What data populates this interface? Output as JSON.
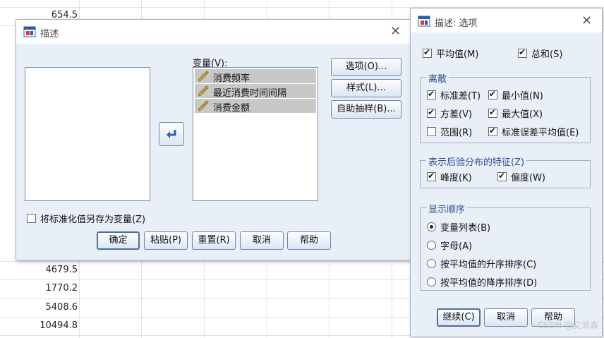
{
  "sheet": {
    "values_top": [
      "654.5"
    ],
    "values_bottom": [
      "4679.5",
      "1770.2",
      "5408.6",
      "10494.8"
    ]
  },
  "describe": {
    "title": "描述",
    "variables_label": "变量(V):",
    "variables": [
      "消费频率",
      "最近消费时间间隔",
      "消费金额"
    ],
    "save_standardized_label": "将标准化值另存为变量(Z)",
    "save_standardized_checked": false,
    "side_buttons": [
      "选项(O)...",
      "样式(L)...",
      "自助抽样(B)..."
    ],
    "bottom_buttons": [
      "确定",
      "粘贴(P)",
      "重置(R)",
      "取消",
      "帮助"
    ]
  },
  "options": {
    "title": "描述: 选项",
    "mean_label": "平均值(M)",
    "sum_label": "总和(S)",
    "dispersion_title": "离散",
    "std_label": "标准差(T)",
    "min_label": "最小值(N)",
    "var_label": "方差(V)",
    "max_label": "最大值(X)",
    "range_label": "范围(R)",
    "se_label": "标准误差平均值(E)",
    "distribution_title": "表示后验分布的特征(Z)",
    "kurtosis_label": "峰度(K)",
    "skewness_label": "偏度(W)",
    "order_title": "显示顺序",
    "order_options": [
      "变量列表(B)",
      "字母(A)",
      "按平均值的升序排序(C)",
      "按平均值的降序排序(D)"
    ],
    "buttons": [
      "继续(C)",
      "取消",
      "帮助"
    ]
  },
  "watermark": "CSDN @艾派森",
  "colors": {
    "dialog_bg": "#e9eff7",
    "group_title": "#2a4d8f",
    "selected_row": "#c8c8c8"
  }
}
